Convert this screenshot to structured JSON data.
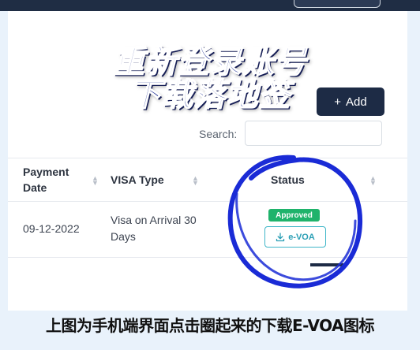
{
  "overlay": {
    "line1": "重新登录账号",
    "line2": "下载落地签"
  },
  "toolbar": {
    "add_icon": "+",
    "add_label": "Add"
  },
  "search": {
    "label": "Search:",
    "value": ""
  },
  "table": {
    "headers": {
      "payment_date_line1": "Payment",
      "payment_date_line2": "Date",
      "visa_type": "VISA Type",
      "status": "Status"
    },
    "rows": [
      {
        "payment_date": "09-12-2022",
        "visa_type_line1": "Visa on Arrival 30",
        "visa_type_line2": "Days",
        "status_badge": "Approved",
        "download_label": "e-VOA"
      }
    ]
  },
  "caption": "上图为手机端界面点击圈起来的下载E-VOA图标",
  "colors": {
    "header_bar": "#1f2d44",
    "approved_badge": "#1fb36b",
    "download_button": "#3fb6c8",
    "highlight_circle": "#1a2bd6"
  }
}
